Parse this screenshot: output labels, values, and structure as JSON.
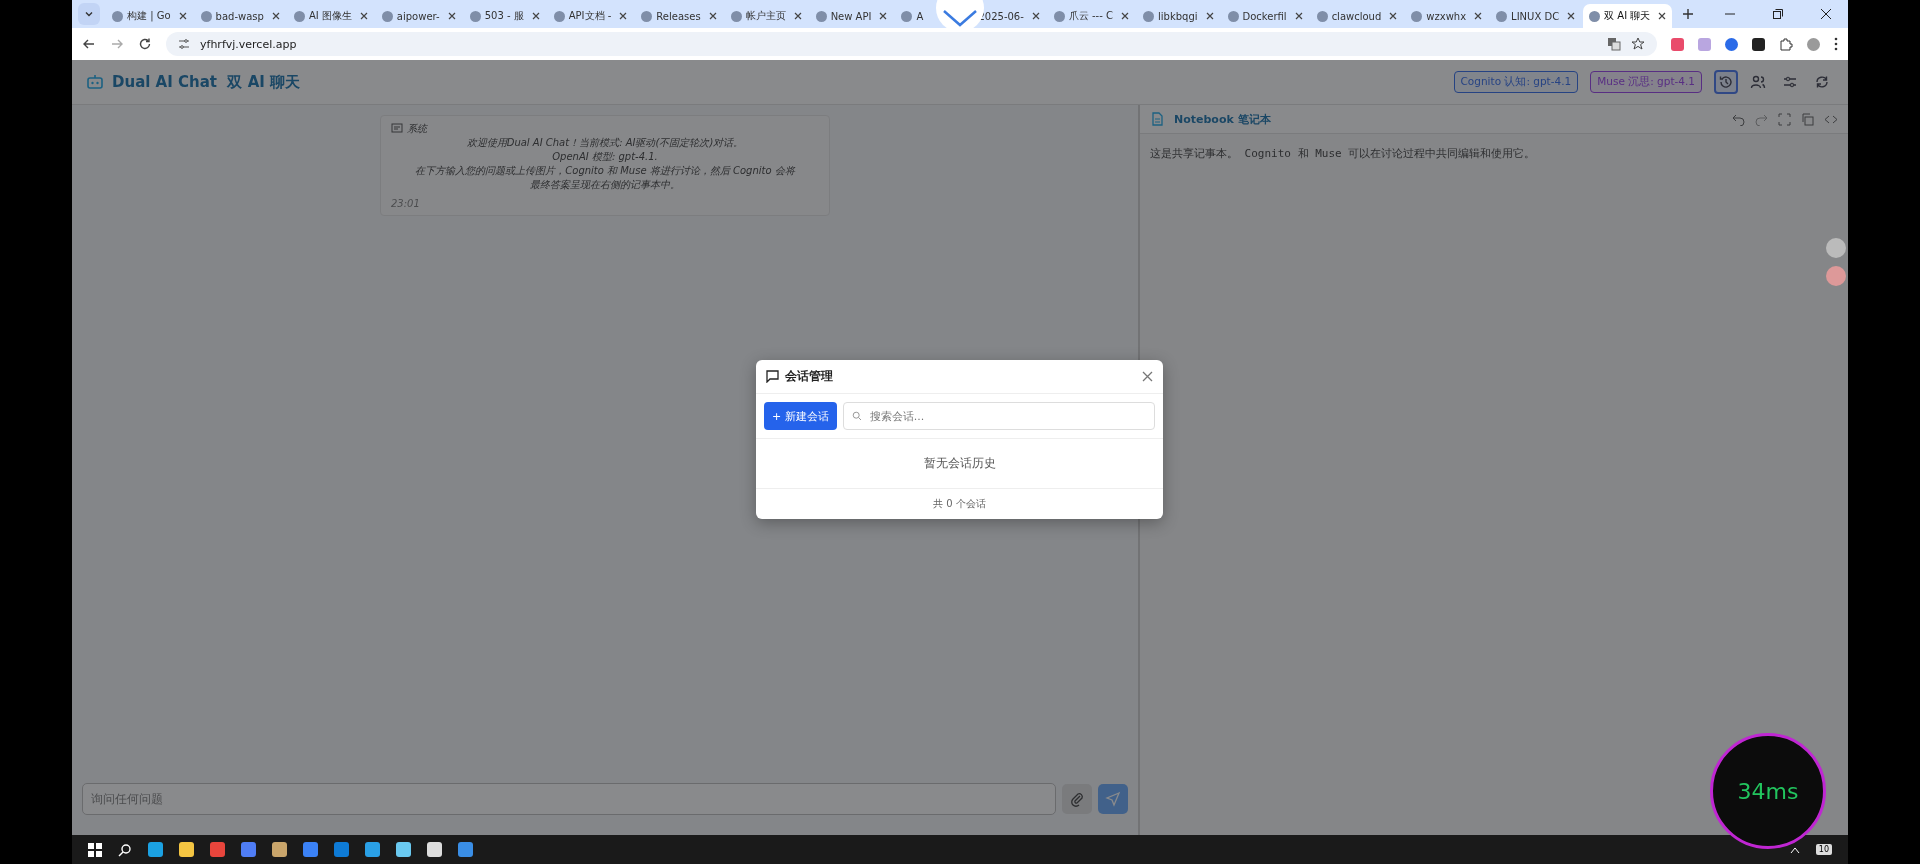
{
  "browser": {
    "tabs": [
      {
        "title": "构建 | Go",
        "selected": false
      },
      {
        "title": "bad-wasp",
        "selected": false
      },
      {
        "title": "AI 图像生",
        "selected": false
      },
      {
        "title": "aipower-",
        "selected": false
      },
      {
        "title": "503 - 服",
        "selected": false
      },
      {
        "title": "API文档 -",
        "selected": false
      },
      {
        "title": "Releases",
        "selected": false
      },
      {
        "title": "帐户主页",
        "selected": false
      },
      {
        "title": "New API",
        "selected": false
      },
      {
        "title": "A",
        "selected": false
      },
      {
        "title": "2025-06-",
        "selected": false
      },
      {
        "title": "爪云 --- C",
        "selected": false
      },
      {
        "title": "libkbqgi",
        "selected": false
      },
      {
        "title": "Dockerfil",
        "selected": false
      },
      {
        "title": "clawcloud",
        "selected": false
      },
      {
        "title": "wzxwhx",
        "selected": false
      },
      {
        "title": "LINUX DC",
        "selected": false
      },
      {
        "title": "双 AI 聊天",
        "selected": true
      }
    ],
    "url": "yfhrfvj.vercel.app"
  },
  "app": {
    "title": "Dual AI Chat  双 AI 聊天",
    "models": [
      {
        "label": "Cognito 认知: gpt-4.1",
        "kind": "cognito"
      },
      {
        "label": "Muse 沉思: gpt-4.1",
        "kind": "muse"
      }
    ],
    "header_buttons": [
      {
        "kind": "history",
        "selected": true
      },
      {
        "kind": "users",
        "selected": false
      },
      {
        "kind": "settings",
        "selected": false
      },
      {
        "kind": "refresh",
        "selected": false
      }
    ]
  },
  "chat": {
    "messages": [
      {
        "sender": "系统",
        "lines": [
          "欢迎使用Dual AI Chat！当前模式: AI驱动(不固定轮次)对话。",
          "OpenAI 模型: gpt-4.1.",
          "在下方输入您的问题或上传图片，Cognito 和 Muse 将进行讨论，然后 Cognito 会将",
          "最终答案呈现在右侧的记事本中。"
        ],
        "time": "23:01"
      }
    ],
    "input_placeholder": "询问任何问题"
  },
  "notebook": {
    "title": "Notebook 笔记本",
    "content": "这是共享记事本。 Cognito 和 Muse 可以在讨论过程中共同编辑和使用它。"
  },
  "modal": {
    "title": "会话管理",
    "new_button": "+ 新建会话",
    "search_placeholder": "搜索会话...",
    "empty_text": "暂无会话历史",
    "footer": "共 0 个会话"
  },
  "taskbar": {
    "notification_count": "10"
  },
  "overlay": {
    "latency": "34ms"
  }
}
